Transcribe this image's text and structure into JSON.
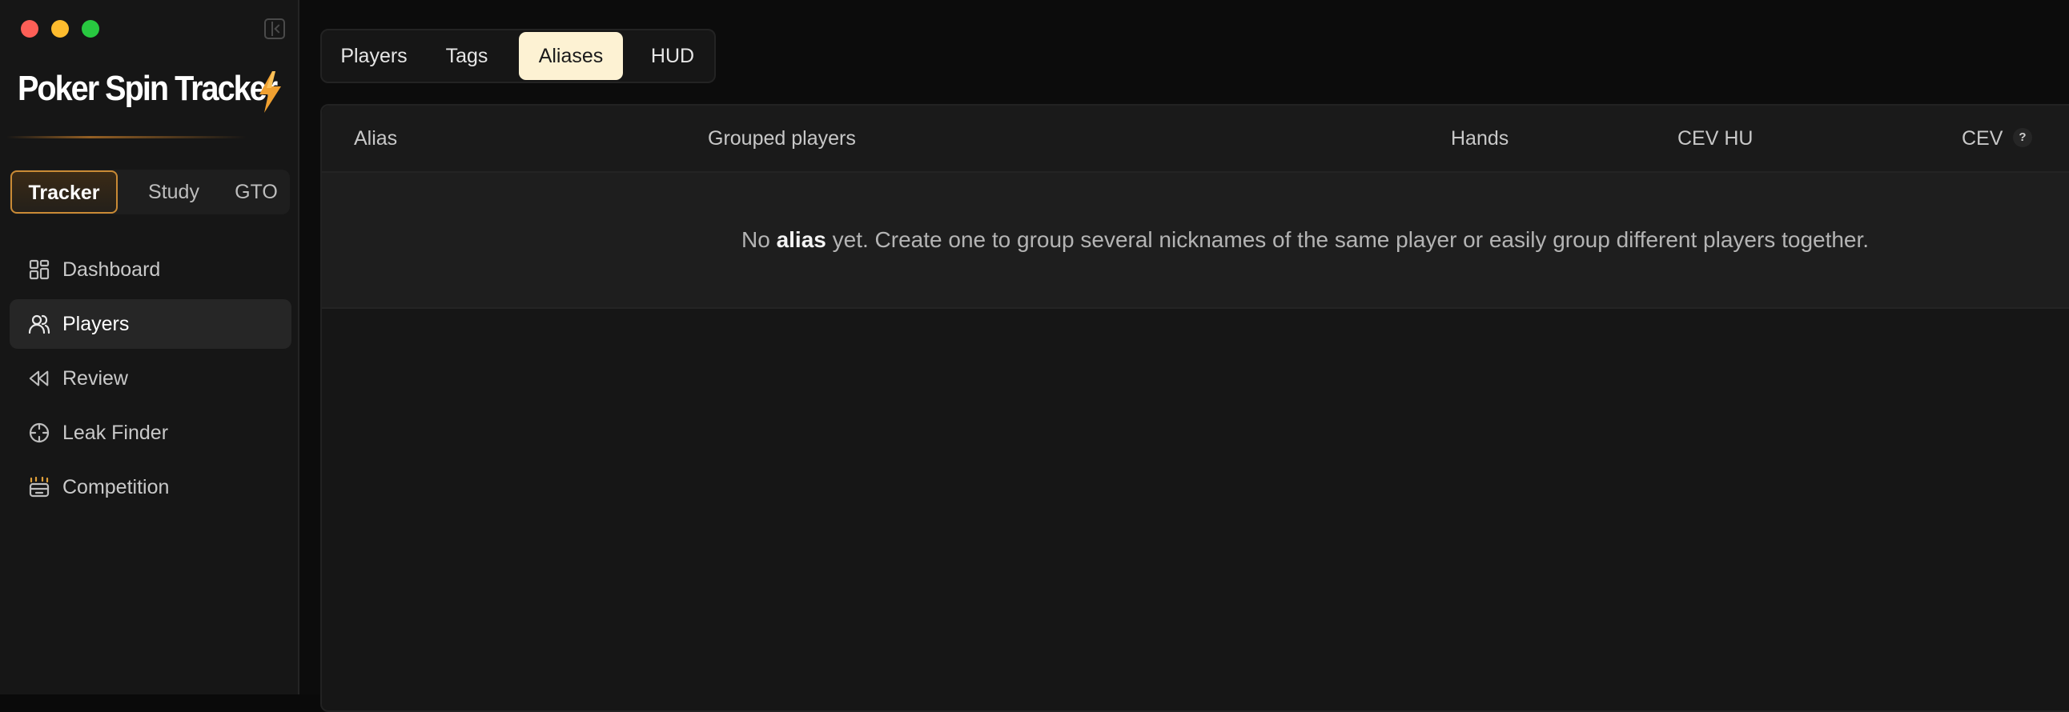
{
  "app": {
    "name": "Poker Spin Tracker",
    "accent_color": "#c98a35",
    "bolt_color": "#f0a030"
  },
  "window_controls": [
    "close",
    "minimize",
    "maximize"
  ],
  "mode_tabs": [
    {
      "label": "Tracker",
      "active": true
    },
    {
      "label": "Study",
      "active": false
    },
    {
      "label": "GTO",
      "active": false
    }
  ],
  "nav": [
    {
      "label": "Dashboard",
      "icon": "dashboard-icon",
      "active": false
    },
    {
      "label": "Players",
      "icon": "users-icon",
      "active": true
    },
    {
      "label": "Review",
      "icon": "rewind-icon",
      "active": false
    },
    {
      "label": "Leak Finder",
      "icon": "crosshair-icon",
      "active": false
    },
    {
      "label": "Competition",
      "icon": "competition-icon",
      "active": false
    }
  ],
  "sub_tabs": [
    {
      "label": "Players",
      "active": false
    },
    {
      "label": "Tags",
      "active": false
    },
    {
      "label": "Aliases",
      "active": true
    },
    {
      "label": "HUD",
      "active": false
    }
  ],
  "table": {
    "columns": [
      "Alias",
      "Grouped players",
      "Hands",
      "CEV HU",
      "CEV"
    ],
    "help_badge": "?",
    "empty": {
      "prefix": "No ",
      "bold": "alias",
      "suffix": " yet. Create one to group several nicknames of the same player or easily group different players together."
    }
  }
}
